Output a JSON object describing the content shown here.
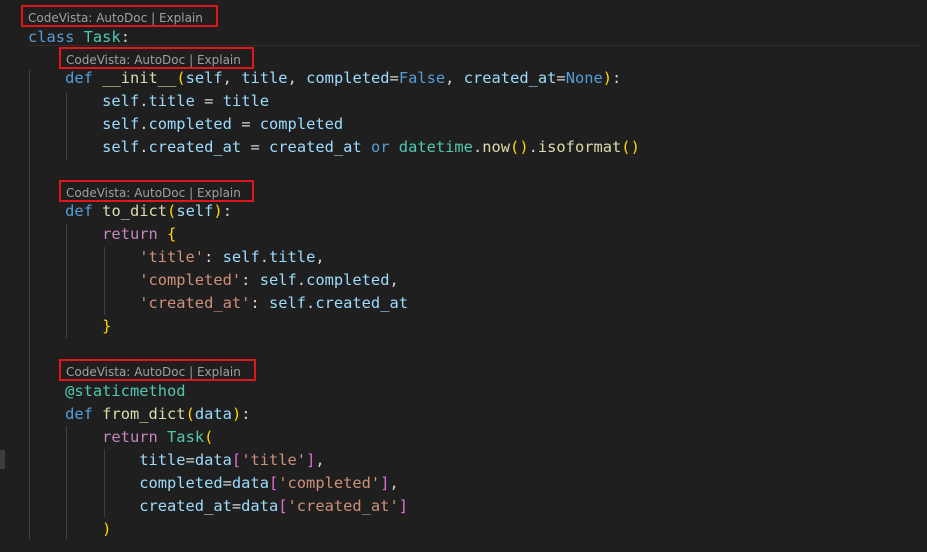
{
  "codelens": {
    "product": "CodeVista:",
    "autodoc": "AutoDoc",
    "separator": "|",
    "explain": "Explain"
  },
  "tokens": {
    "class": "class",
    "def": "def",
    "return": "return",
    "or": "or",
    "colon": ":",
    "comma": ",",
    "assign": "=",
    "dot": ".",
    "paren_open": "(",
    "paren_close": ")",
    "brace_open": "{",
    "brace_close": "}",
    "bracket_open": "[",
    "bracket_close": "]",
    "self": "self",
    "Task": "Task",
    "init": "__init__",
    "to_dict": "to_dict",
    "from_dict": "from_dict",
    "title": "title",
    "completed": "completed",
    "created_at": "created_at",
    "False": "False",
    "None": "None",
    "datetime": "datetime",
    "now": "now",
    "isoformat": "isoformat",
    "decorator": "@staticmethod",
    "data": "data",
    "s_title": "'title'",
    "s_completed": "'completed'",
    "s_created_at": "'created_at'"
  },
  "colors": {
    "background": "#1f1f1f",
    "keyword": "#569cd6",
    "control_keyword": "#c586c0",
    "class_name": "#4ec9b0",
    "function": "#dcdcaa",
    "variable": "#9cdcfe",
    "string": "#ce9178",
    "bracket_level_1": "#ffd700",
    "bracket_level_2": "#da70d6",
    "bracket_level_3": "#179fff",
    "codelens_highlight_border": "#e0161c"
  }
}
